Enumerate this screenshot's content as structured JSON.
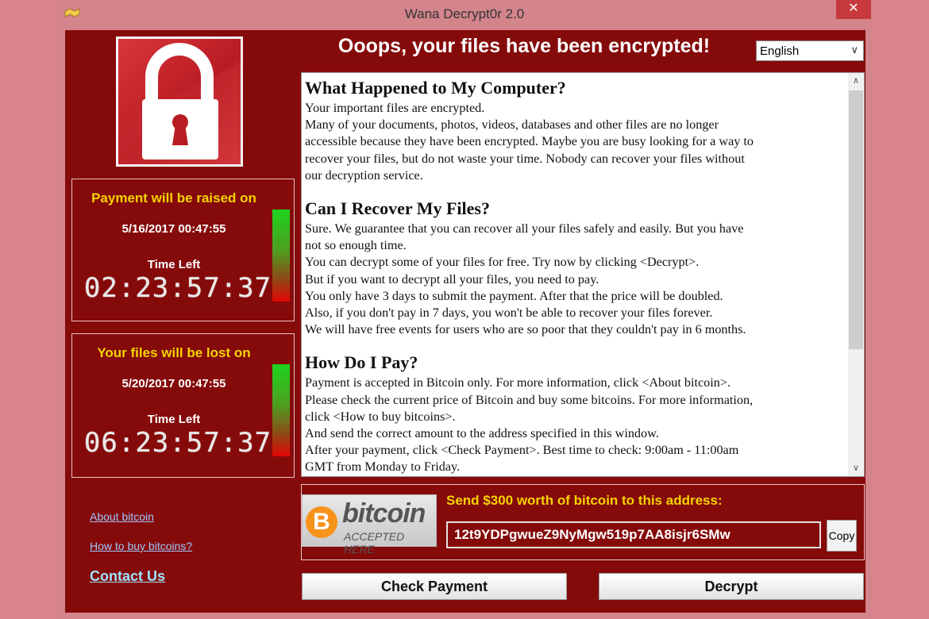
{
  "window": {
    "title": "Wana Decrypt0r 2.0",
    "close_glyph": "✕"
  },
  "header": {
    "headline": "Ooops, your files have been encrypted!",
    "language": "English"
  },
  "timers": [
    {
      "heading": "Payment will be raised on",
      "date": "5/16/2017 00:47:55",
      "time_left_label": "Time Left",
      "countdown": "02:23:57:37"
    },
    {
      "heading": "Your files will be lost on",
      "date": "5/20/2017 00:47:55",
      "time_left_label": "Time Left",
      "countdown": "06:23:57:37"
    }
  ],
  "links": {
    "about_bitcoin": "About bitcoin",
    "how_to_buy": "How to buy bitcoins?",
    "contact_us": "Contact Us"
  },
  "message": {
    "sections": [
      {
        "heading": "What Happened to My Computer?",
        "lines": [
          "Your important files are encrypted.",
          "Many of your documents, photos, videos, databases and other files are no longer",
          "accessible because they have been encrypted. Maybe you are busy looking for a way to",
          "recover your files, but do not waste your time. Nobody can recover your files without",
          "our decryption service."
        ]
      },
      {
        "heading": "Can I Recover My Files?",
        "lines": [
          "Sure. We guarantee that you can recover all your files safely and easily. But you have",
          "not so enough time.",
          "You can decrypt some of your files for free. Try now by clicking <Decrypt>.",
          "But if you want to decrypt all your files, you need to pay.",
          "You only have 3 days to submit the payment. After that the price will be doubled.",
          "Also, if you don't pay in 7 days, you won't be able to recover your files forever.",
          "We will have free events for users who are so poor that they couldn't pay in 6 months."
        ]
      },
      {
        "heading": "How Do I Pay?",
        "lines": [
          "Payment is accepted in Bitcoin only. For more information, click <About bitcoin>.",
          "Please check the current price of Bitcoin and buy some bitcoins. For more information,",
          "click <How to buy bitcoins>.",
          "And send the correct amount to the address specified in this window.",
          "After your payment, click <Check Payment>. Best time to check: 9:00am - 11:00am",
          "GMT from Monday to Friday."
        ]
      }
    ]
  },
  "bitcoin": {
    "logo_word": "bitcoin",
    "logo_sub": "ACCEPTED HERE",
    "coin_glyph": "B",
    "send_label": "Send $300 worth of bitcoin to this address:",
    "address": "12t9YDPgwueZ9NyMgw519p7AA8isjr6SMw",
    "copy_label": "Copy"
  },
  "actions": {
    "check_payment": "Check Payment",
    "decrypt": "Decrypt"
  },
  "colors": {
    "background": "#d9858b",
    "panel": "#850a0a",
    "accent_yellow": "#f4d400",
    "link": "#9ec8ff"
  }
}
